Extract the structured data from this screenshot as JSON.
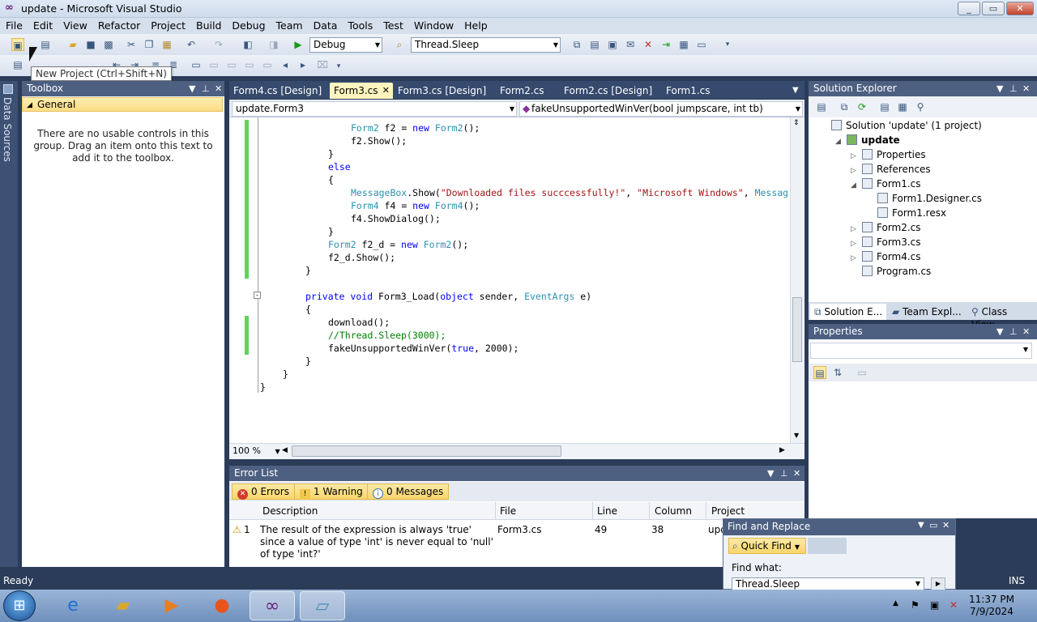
{
  "window": {
    "title": "update - Microsoft Visual Studio",
    "minimize_label": "_",
    "restore_label": "▭",
    "close_label": "✕"
  },
  "menu": [
    "File",
    "Edit",
    "View",
    "Refactor",
    "Project",
    "Build",
    "Debug",
    "Team",
    "Data",
    "Tools",
    "Test",
    "Window",
    "Help"
  ],
  "toolbar": {
    "config_value": "Debug",
    "find_value": "Thread.Sleep"
  },
  "tooltip": "New Project (Ctrl+Shift+N)",
  "data_sources_label": "Data Sources",
  "toolbox": {
    "title": "Toolbox",
    "group": "General",
    "empty_message": "There are no usable controls in this group. Drag an item onto this text to add it to the toolbox."
  },
  "tabs": [
    "Form4.cs [Design]",
    "Form3.cs",
    "Form3.cs [Design]",
    "Form2.cs",
    "Form2.cs [Design]",
    "Form1.cs"
  ],
  "nav": {
    "class_value": "update.Form3",
    "member_value": "fakeUnsupportedWinVer(bool jumpscare, int tb)"
  },
  "code_lines": [
    {
      "indent": 4,
      "tokens": [
        {
          "t": "Form2",
          "c": "ty"
        },
        {
          "t": " f2 = "
        },
        {
          "t": "new",
          "c": "kw"
        },
        {
          "t": " "
        },
        {
          "t": "Form2",
          "c": "ty"
        },
        {
          "t": "();"
        }
      ]
    },
    {
      "indent": 4,
      "tokens": [
        {
          "t": "f2.Show();"
        }
      ]
    },
    {
      "indent": 3,
      "tokens": [
        {
          "t": "}"
        }
      ]
    },
    {
      "indent": 3,
      "tokens": [
        {
          "t": "else",
          "c": "kw"
        }
      ]
    },
    {
      "indent": 3,
      "tokens": [
        {
          "t": "{"
        }
      ]
    },
    {
      "indent": 4,
      "tokens": [
        {
          "t": "MessageBox",
          "c": "ty"
        },
        {
          "t": ".Show("
        },
        {
          "t": "\"Downloaded files succcessfully!\"",
          "c": "st"
        },
        {
          "t": ", "
        },
        {
          "t": "\"Microsoft Windows\"",
          "c": "st"
        },
        {
          "t": ", "
        },
        {
          "t": "Messag",
          "c": "ty"
        }
      ]
    },
    {
      "indent": 4,
      "tokens": [
        {
          "t": "Form4",
          "c": "ty"
        },
        {
          "t": " f4 = "
        },
        {
          "t": "new",
          "c": "kw"
        },
        {
          "t": " "
        },
        {
          "t": "Form4",
          "c": "ty"
        },
        {
          "t": "();"
        }
      ]
    },
    {
      "indent": 4,
      "tokens": [
        {
          "t": "f4.ShowDialog();"
        }
      ]
    },
    {
      "indent": 3,
      "tokens": [
        {
          "t": "}"
        }
      ]
    },
    {
      "indent": 3,
      "tokens": [
        {
          "t": "Form2",
          "c": "ty"
        },
        {
          "t": " f2_d = "
        },
        {
          "t": "new",
          "c": "kw"
        },
        {
          "t": " "
        },
        {
          "t": "Form2",
          "c": "ty"
        },
        {
          "t": "();"
        }
      ]
    },
    {
      "indent": 3,
      "tokens": [
        {
          "t": "f2_d.Show();"
        }
      ]
    },
    {
      "indent": 2,
      "tokens": [
        {
          "t": "}"
        }
      ]
    },
    {
      "indent": 0,
      "tokens": []
    },
    {
      "indent": 2,
      "tokens": [
        {
          "t": "private",
          "c": "kw"
        },
        {
          "t": " "
        },
        {
          "t": "void",
          "c": "kw"
        },
        {
          "t": " Form3_Load("
        },
        {
          "t": "object",
          "c": "kw"
        },
        {
          "t": " sender, "
        },
        {
          "t": "EventArgs",
          "c": "ty"
        },
        {
          "t": " e)"
        }
      ]
    },
    {
      "indent": 2,
      "tokens": [
        {
          "t": "{"
        }
      ]
    },
    {
      "indent": 3,
      "tokens": [
        {
          "t": "download();"
        }
      ]
    },
    {
      "indent": 3,
      "tokens": [
        {
          "t": "//Thread.Sleep(3000);",
          "c": "cm"
        }
      ]
    },
    {
      "indent": 3,
      "tokens": [
        {
          "t": "fakeUnsupportedWinVer("
        },
        {
          "t": "true",
          "c": "kw"
        },
        {
          "t": ", 2000);"
        }
      ]
    },
    {
      "indent": 2,
      "tokens": [
        {
          "t": "}"
        }
      ]
    },
    {
      "indent": 1,
      "tokens": [
        {
          "t": "}"
        }
      ]
    },
    {
      "indent": 0,
      "tokens": [
        {
          "t": "}"
        }
      ]
    }
  ],
  "zoom_level": "100 %",
  "error_list": {
    "title": "Error List",
    "errors_btn": "0 Errors",
    "warnings_btn": "1 Warning",
    "messages_btn": "0 Messages",
    "columns": [
      "Description",
      "File",
      "Line",
      "Column",
      "Project"
    ],
    "rows": [
      {
        "num": "1",
        "description": "The result of the expression is always 'true' since a value of type 'int' is never equal to 'null' of type 'int?'",
        "file": "Form3.cs",
        "line": "49",
        "column": "38",
        "project": "upd"
      }
    ]
  },
  "solution_explorer": {
    "title": "Solution Explorer",
    "items": [
      {
        "label": "Solution 'update' (1 project)",
        "level": 0,
        "expander": ""
      },
      {
        "label": "update",
        "level": 1,
        "expander": "◢",
        "bold": true
      },
      {
        "label": "Properties",
        "level": 2,
        "expander": "▷"
      },
      {
        "label": "References",
        "level": 2,
        "expander": "▷"
      },
      {
        "label": "Form1.cs",
        "level": 2,
        "expander": "◢"
      },
      {
        "label": "Form1.Designer.cs",
        "level": 3,
        "expander": ""
      },
      {
        "label": "Form1.resx",
        "level": 3,
        "expander": ""
      },
      {
        "label": "Form2.cs",
        "level": 2,
        "expander": "▷"
      },
      {
        "label": "Form3.cs",
        "level": 2,
        "expander": "▷"
      },
      {
        "label": "Form4.cs",
        "level": 2,
        "expander": "▷"
      },
      {
        "label": "Program.cs",
        "level": 2,
        "expander": ""
      }
    ],
    "bottom_tabs": [
      "Solution E...",
      "Team Expl...",
      "Class View"
    ]
  },
  "properties": {
    "title": "Properties"
  },
  "find_replace": {
    "title": "Find and Replace",
    "mode": "Quick Find",
    "find_what_label": "Find what:",
    "find_what_value": "Thread.Sleep"
  },
  "status": {
    "left": "Ready",
    "right": "INS"
  },
  "taskbar": {
    "time": "11:37 PM",
    "date": "7/9/2024"
  },
  "colors": {
    "accent": "#4d6082",
    "active_tab": "#fdf4bf",
    "statusbar": "#2b3c59"
  }
}
